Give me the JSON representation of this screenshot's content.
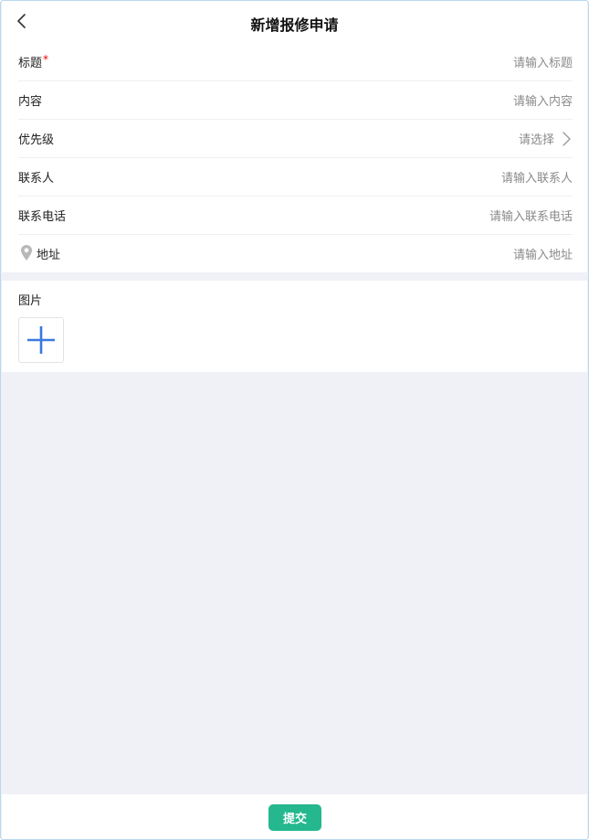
{
  "header": {
    "title": "新增报修申请",
    "back_icon": "chevron-left-icon"
  },
  "form": {
    "fields": [
      {
        "label": "标题",
        "required_mark": "*",
        "placeholder": "请输入标题"
      },
      {
        "label": "内容",
        "placeholder": "请输入内容"
      },
      {
        "label": "优先级",
        "placeholder": "请选择",
        "icon": "chevron-right-icon"
      },
      {
        "label": "联系人",
        "placeholder": "请输入联系人"
      },
      {
        "label": "联系电话",
        "placeholder": "请输入联系电话"
      },
      {
        "label": "地址",
        "placeholder": "请输入地址",
        "icon": "location-pin-icon"
      }
    ]
  },
  "images": {
    "label": "图片",
    "add_icon": "plus-icon"
  },
  "footer": {
    "submit_label": "提交"
  },
  "colors": {
    "accent": "#25b88f",
    "required": "#f00000",
    "plus": "#3a78e0",
    "page_background": "#eff1f6",
    "placeholder_text": "#8a8a8a"
  }
}
